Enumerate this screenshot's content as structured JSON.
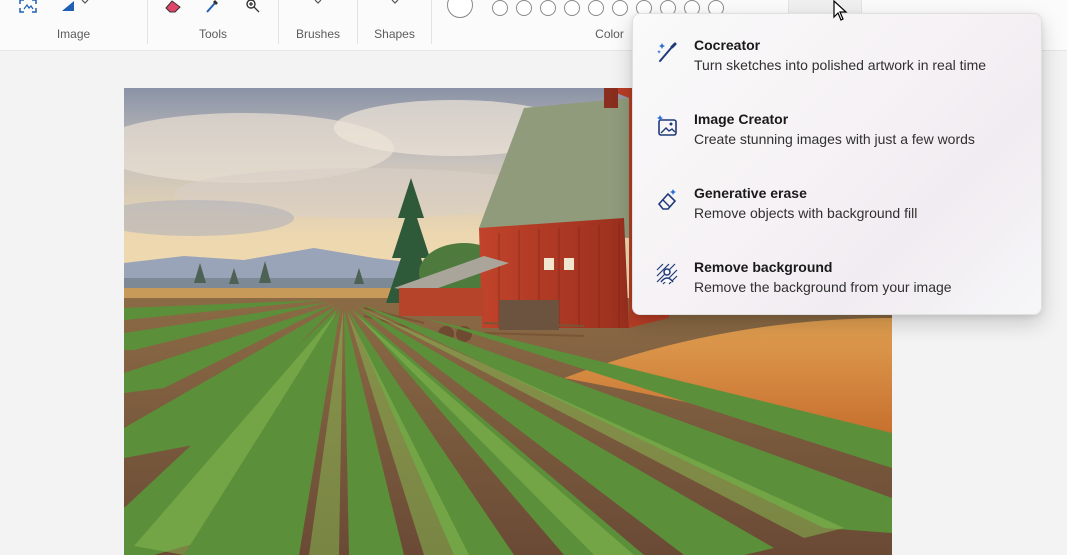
{
  "ribbon": {
    "groups": {
      "image": "Image",
      "tools": "Tools",
      "brushes": "Brushes",
      "shapes": "Shapes",
      "color": "Color"
    }
  },
  "canvas": {
    "content": "painting-farm-barn-crop-rows"
  },
  "ai_menu": {
    "items": [
      {
        "title": "Cocreator",
        "description": "Turn sketches into polished artwork in real time",
        "icon": "cocreator-brush-sparkle-icon"
      },
      {
        "title": "Image Creator",
        "description": "Create stunning images with just a few words",
        "icon": "image-sparkle-icon"
      },
      {
        "title": "Generative erase",
        "description": "Remove objects with background fill",
        "icon": "eraser-sparkle-icon"
      },
      {
        "title": "Remove background",
        "description": "Remove the background from your image",
        "icon": "remove-background-icon"
      }
    ]
  },
  "colors": {
    "accent": "#0f6cbd",
    "menu_bg": "#f7f4f6"
  }
}
